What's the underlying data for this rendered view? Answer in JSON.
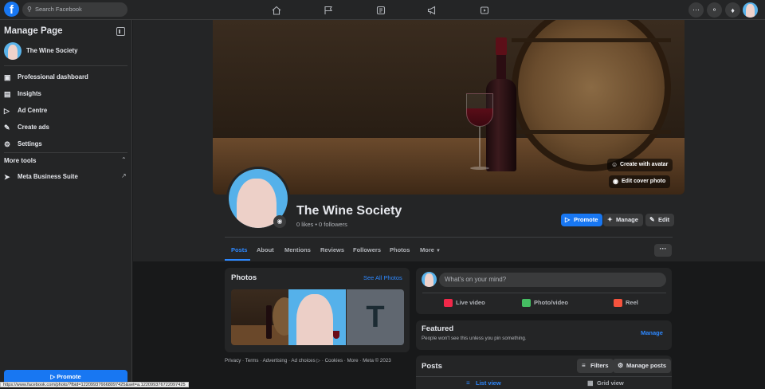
{
  "topbar": {
    "search_placeholder": "Search Facebook",
    "nav_icons": [
      "home-icon",
      "flag-icon",
      "pages-icon",
      "megaphone-icon",
      "video-icon"
    ],
    "right_icons": [
      "menu-grid-icon",
      "messenger-icon",
      "notifications-icon",
      "account-avatar"
    ]
  },
  "sidebar": {
    "title": "Manage Page",
    "page_name": "The Wine Society",
    "items": [
      {
        "label": "Professional dashboard",
        "icon": "dashboard-icon"
      },
      {
        "label": "Insights",
        "icon": "insights-icon"
      },
      {
        "label": "Ad Centre",
        "icon": "megaphone-icon"
      },
      {
        "label": "Create ads",
        "icon": "edit-icon"
      },
      {
        "label": "Settings",
        "icon": "gear-icon"
      }
    ],
    "more_tools_label": "More tools",
    "tools": [
      {
        "label": "Meta Business Suite",
        "icon": "business-suite-icon"
      }
    ],
    "promote_label": "Promote"
  },
  "cover": {
    "create_avatar_label": "Create with avatar",
    "edit_cover_label": "Edit cover photo"
  },
  "profile": {
    "name": "The Wine Society",
    "stats": "0 likes • 0 followers",
    "promote_label": "Promote",
    "manage_label": "Manage",
    "edit_label": "Edit"
  },
  "tabs": [
    {
      "label": "Posts",
      "active": true
    },
    {
      "label": "About"
    },
    {
      "label": "Mentions"
    },
    {
      "label": "Reviews"
    },
    {
      "label": "Followers"
    },
    {
      "label": "Photos"
    },
    {
      "label": "More"
    }
  ],
  "photos_card": {
    "title": "Photos",
    "see_all": "See All Photos",
    "placeholder_letter": "T"
  },
  "footer_links": "Privacy · Terms · Advertising · Ad choices ▷ · Cookies · More · Meta © 2023",
  "composer": {
    "placeholder": "What's on your mind?",
    "actions": [
      {
        "label": "Live video",
        "icon": "live-video-icon",
        "color": "#f02849"
      },
      {
        "label": "Photo/video",
        "icon": "photo-icon",
        "color": "#45bd62"
      },
      {
        "label": "Reel",
        "icon": "reel-icon",
        "color": "#f5533d"
      }
    ]
  },
  "featured": {
    "title": "Featured",
    "subtitle": "People won't see this unless you pin something.",
    "manage_label": "Manage"
  },
  "posts_card": {
    "title": "Posts",
    "filters_label": "Filters",
    "manage_posts_label": "Manage posts",
    "list_view_label": "List view",
    "grid_view_label": "Grid view"
  },
  "status_url": "https://www.facebook.com/photo/?fbid=122099376668097425&set=a.122099376722097425",
  "colors": {
    "accent": "#1877f2",
    "link": "#2d88ff",
    "bg": "#18191a",
    "surface": "#242526"
  }
}
